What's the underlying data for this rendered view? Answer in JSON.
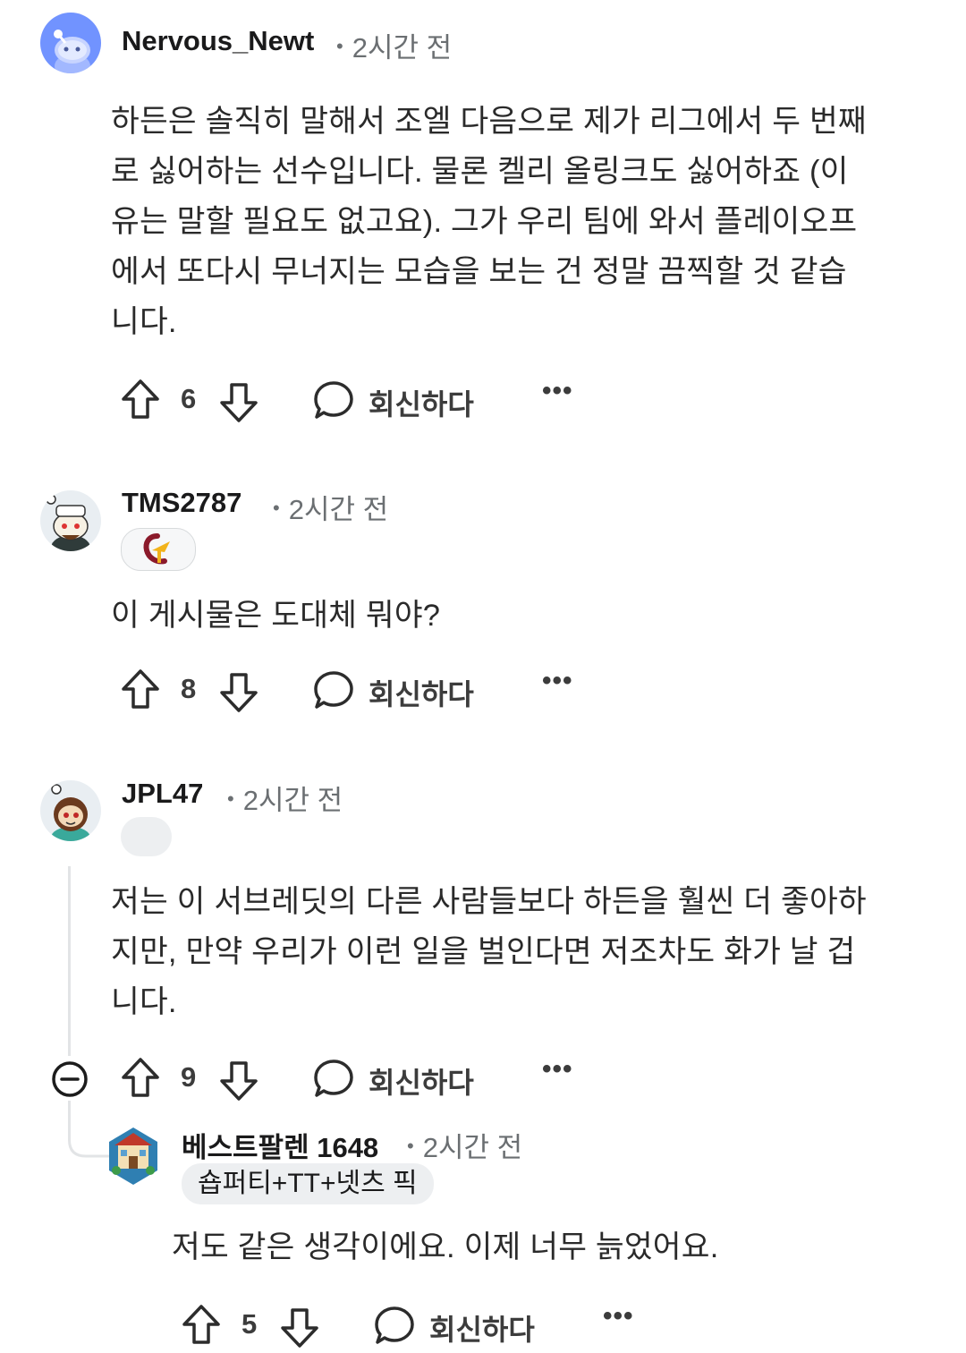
{
  "comments": [
    {
      "username": "Nervous_Newt",
      "time": "2시간 전",
      "body_lines": [
        "하든은 솔직히 말해서 조엘 다음으로 제가 리그에서 두 번째",
        "로 싫어하는 선수입니다. 물론 켈리 올링크도 싫어하죠 (이",
        "유는 말할 필요도 없고요). 그가 우리 팀에 와서 플레이오프",
        "에서 또다시 무너지는 모습을 보는 건 정말 끔찍할 것 같습",
        "니다."
      ],
      "votes": "6",
      "reply_label": "회신하다",
      "more": "•••"
    },
    {
      "username": "TMS2787",
      "time": "2시간 전",
      "body_lines": [
        "이 게시물은 도대체 뭐야?"
      ],
      "votes": "8",
      "reply_label": "회신하다",
      "more": "•••"
    },
    {
      "username": "JPL47",
      "time": "2시간 전",
      "body_lines": [
        "저는 이 서브레딧의 다른 사람들보다 하든을 훨씬 더 좋아하",
        "지만, 만약 우리가 이런 일을 벌인다면 저조차도 화가 날 겁",
        "니다."
      ],
      "votes": "9",
      "reply_label": "회신하다",
      "more": "•••"
    },
    {
      "username": "베스트팔렌 1648",
      "time": "2시간 전",
      "flair": "숍퍼티+TT+넷츠 픽",
      "body_lines": [
        "저도 같은 생각이에요. 이제 너무 늙었어요."
      ],
      "votes": "5",
      "reply_label": "회신하다",
      "more": "•••"
    }
  ],
  "colors": {
    "text": "#1a1a1b",
    "meta": "#6b6f72",
    "thread_line": "#e2e4e6",
    "flair_bg": "#edeff1",
    "snoo_blue": "#7193ff"
  },
  "icons": [
    "upvote-icon",
    "downvote-icon",
    "reply-icon",
    "more-icon",
    "collapse-icon"
  ]
}
